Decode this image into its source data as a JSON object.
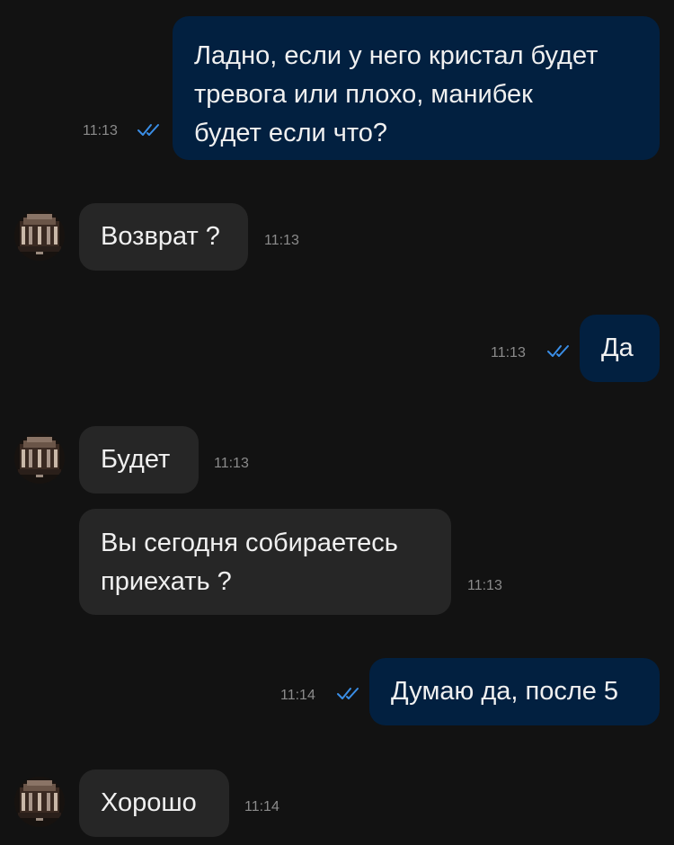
{
  "theme": {
    "background": "#121212",
    "outgoing_bubble": "#022040",
    "incoming_bubble": "#262626",
    "read_ticks": "#3a8ee6",
    "timestamp": "#8b8b8b"
  },
  "messages": [
    {
      "direction": "outgoing",
      "lines": [
        "Ладно, если у него кристал будет",
        "тревога или плохо, манибек",
        "будет если что?"
      ],
      "time": "11:13",
      "status_icon": "double-check-icon"
    },
    {
      "direction": "incoming",
      "lines": [
        "Возврат ?"
      ],
      "time": "11:13",
      "avatar": "avatar-image"
    },
    {
      "direction": "outgoing",
      "lines": [
        "Да"
      ],
      "time": "11:13",
      "status_icon": "double-check-icon"
    },
    {
      "direction": "incoming",
      "lines": [
        "Будет"
      ],
      "time": "11:13",
      "avatar": "avatar-image"
    },
    {
      "direction": "incoming",
      "lines": [
        "Вы сегодня собираетесь",
        "приехать ?"
      ],
      "time": "11:13"
    },
    {
      "direction": "outgoing",
      "lines": [
        "Думаю да, после 5"
      ],
      "time": "11:14",
      "status_icon": "double-check-icon"
    },
    {
      "direction": "incoming",
      "lines": [
        "Хорошо"
      ],
      "time": "11:14",
      "avatar": "avatar-image"
    }
  ]
}
